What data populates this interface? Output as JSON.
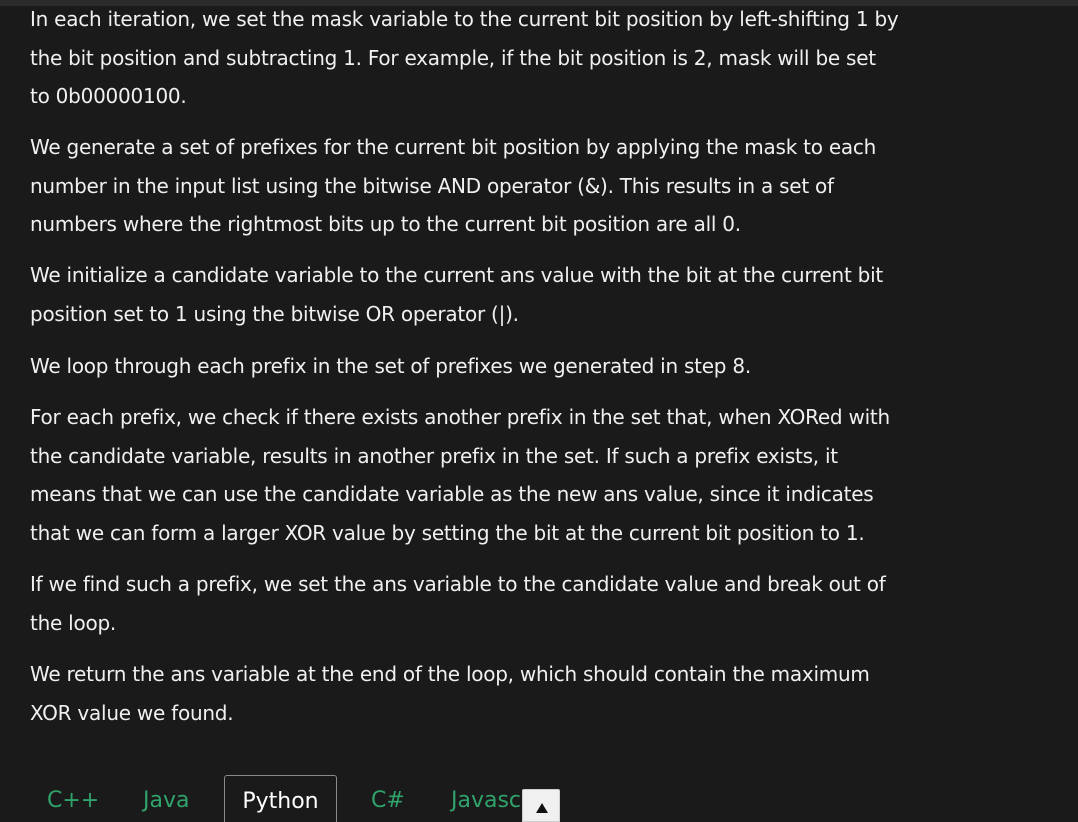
{
  "paragraphs": [
    [
      "In each iteration, we set the mask variable to the current bit position by left-shifting 1 by",
      "the bit position and subtracting 1. For example, if the bit position is 2, mask will be set",
      "to 0b00000100."
    ],
    [
      "We generate a set of prefixes for the current bit position by applying the mask to each",
      "number in the input list using the bitwise AND operator (&). This results in a set of",
      "numbers where the rightmost bits up to the current bit position are all 0."
    ],
    [
      "We initialize a candidate variable to the current ans value with the bit at the current bit",
      "position set to 1 using the bitwise OR operator (|)."
    ],
    [
      "We loop through each prefix in the set of prefixes we generated in step 8."
    ],
    [
      "For each prefix, we check if there exists another prefix in the set that, when XORed with",
      "the candidate variable, results in another prefix in the set. If such a prefix exists, it",
      "means that we can use the candidate variable as the new ans value, since it indicates",
      "that we can form a larger XOR value by setting the bit at the current bit position to 1."
    ],
    [
      "If we find such a prefix, we set the ans variable to the candidate value and break out of",
      "the loop."
    ],
    [
      "We return the ans variable at the end of the loop, which should contain the maximum",
      "XOR value we found."
    ]
  ],
  "tabs": {
    "cpp": "C++",
    "java": "Java",
    "python": "Python",
    "csharp": "C#",
    "javascript": "Javasc"
  },
  "active_tab": "Python",
  "icons": {
    "scroll_top": "arrow-up-icon"
  },
  "colors": {
    "background": "#1a1a1a",
    "text": "#f0f0f0",
    "tab_inactive": "#2fa36b",
    "tab_active": "#ffffff"
  }
}
